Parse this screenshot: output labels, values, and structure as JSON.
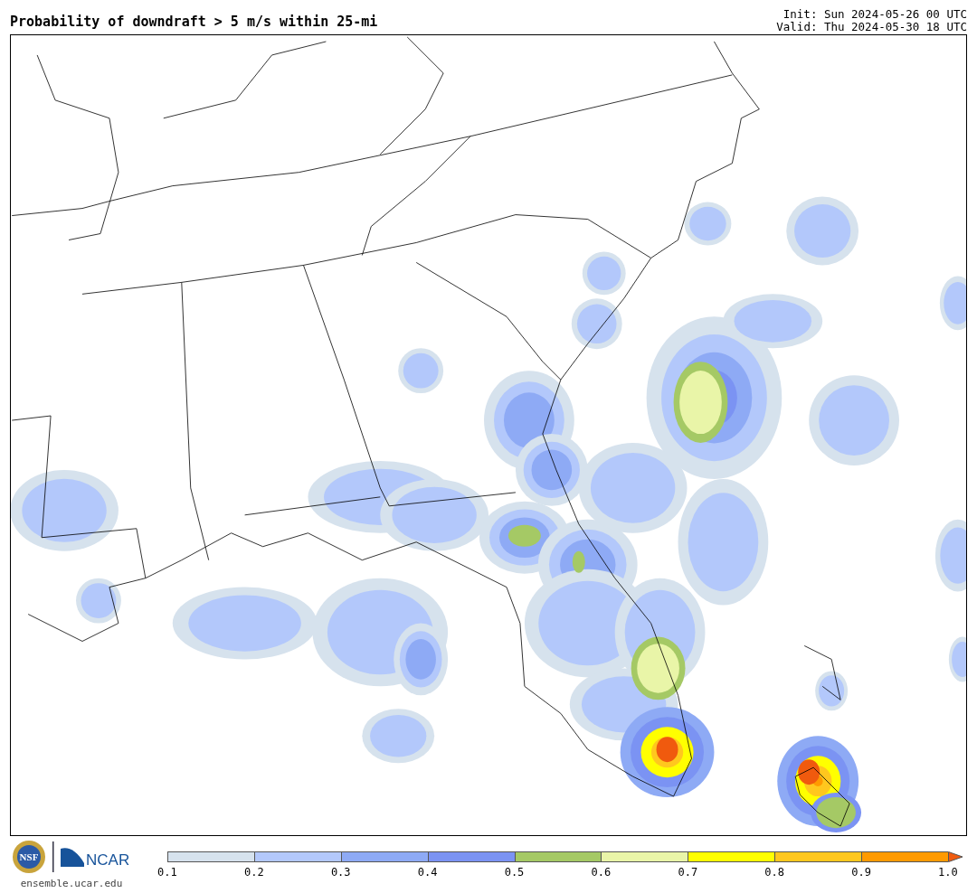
{
  "title": "Probability of downdraft > 5 m/s within 25-mi",
  "init": "Init: Sun 2024-05-26 00 UTC",
  "valid": "Valid: Thu 2024-05-30 18 UTC",
  "logos": {
    "seal": "NSF",
    "wordmark": "NCAR"
  },
  "site": "ensemble.ucar.edu",
  "colorbar": {
    "segments": [
      {
        "kind": "band",
        "color": "#d6e2ed"
      },
      {
        "kind": "band",
        "color": "#b3c8fb"
      },
      {
        "kind": "band",
        "color": "#8eaaf5"
      },
      {
        "kind": "band",
        "color": "#7b93f3"
      },
      {
        "kind": "band",
        "color": "#a5c965"
      },
      {
        "kind": "band",
        "color": "#e9f5a8"
      },
      {
        "kind": "band",
        "color": "#ffff00"
      },
      {
        "kind": "band",
        "color": "#ffc71e"
      },
      {
        "kind": "band",
        "color": "#ff9a00"
      },
      {
        "kind": "arrow",
        "color": "#f05a0e"
      }
    ],
    "ticks": [
      "0.1",
      "0.2",
      "0.3",
      "0.4",
      "0.5",
      "0.6",
      "0.7",
      "0.8",
      "0.9",
      "1.0"
    ]
  }
}
